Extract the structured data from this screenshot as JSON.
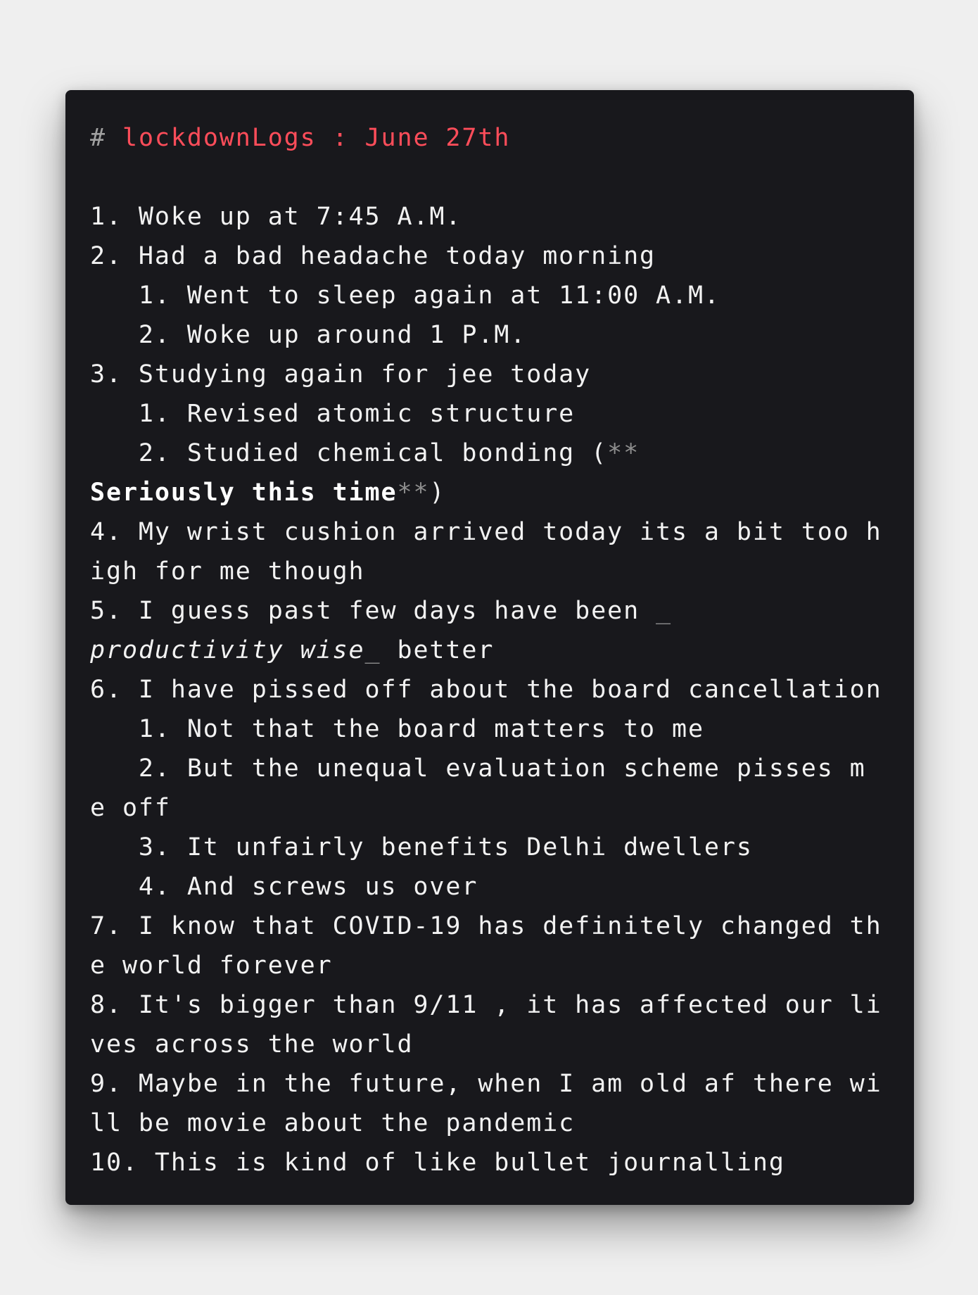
{
  "heading": {
    "hash": "#",
    "title": "lockdownLogs : June 27th"
  },
  "lines": [
    "1. Woke up at 7:45 A.M.",
    "2. Had a bad headache today morning",
    "   1. Went to sleep again at 11:00 A.M.",
    "   2. Woke up around 1 P.M.",
    "3. Studying again for jee today",
    "   1. Revised atomic structure",
    "   2. Studied chemical bonding (",
    "**",
    "Seriously this time",
    "**",
    ")",
    "4. My wrist cushion arrived today its a bit too h",
    "igh for me though",
    "5. I guess past few days have been ",
    "_",
    "productivity wise",
    "_",
    " better",
    "6. I have pissed off about the board cancellation",
    "   1. Not that the board matters to me",
    "   2. But the unequal evaluation scheme pisses m",
    "e off",
    "   3. It unfairly benefits Delhi dwellers",
    "   4. And screws us over",
    "7. I know that COVID-19 has definitely changed th",
    "e world forever",
    "8. It's bigger than 9/11 , it has affected our li",
    "ves across the world",
    "9. Maybe in the future, when I am old af there wi",
    "ll be movie about the pandemic",
    "10. This is kind of like bullet journalling"
  ]
}
